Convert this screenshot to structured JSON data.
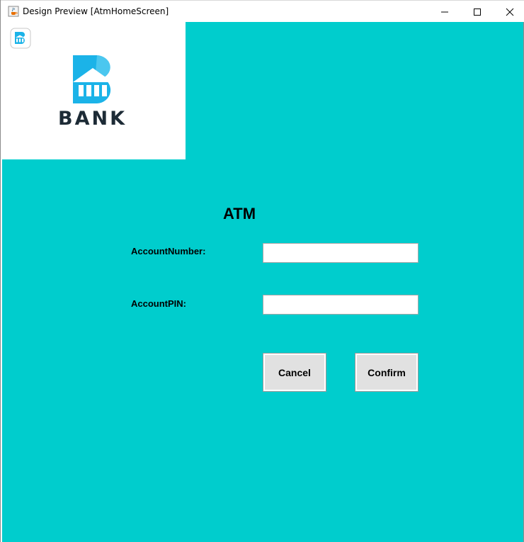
{
  "window": {
    "title": "Design Preview [AtmHomeScreen]",
    "icons": [
      "java-cup-icon",
      "minimize-icon",
      "maximize-icon",
      "close-icon"
    ]
  },
  "logo": {
    "text": "BANK",
    "colors": {
      "brand_blue": "#1bb3e8",
      "text_dark": "#1d2b36"
    }
  },
  "form": {
    "heading": "ATM",
    "account_number_label": "AccountNumber:",
    "account_number_value": "",
    "account_pin_label": "AccountPIN:",
    "account_pin_value": ""
  },
  "buttons": {
    "cancel": "Cancel",
    "confirm": "Confirm"
  },
  "theme": {
    "background": "#00cdcd",
    "button_bg": "#e1e1e1"
  }
}
